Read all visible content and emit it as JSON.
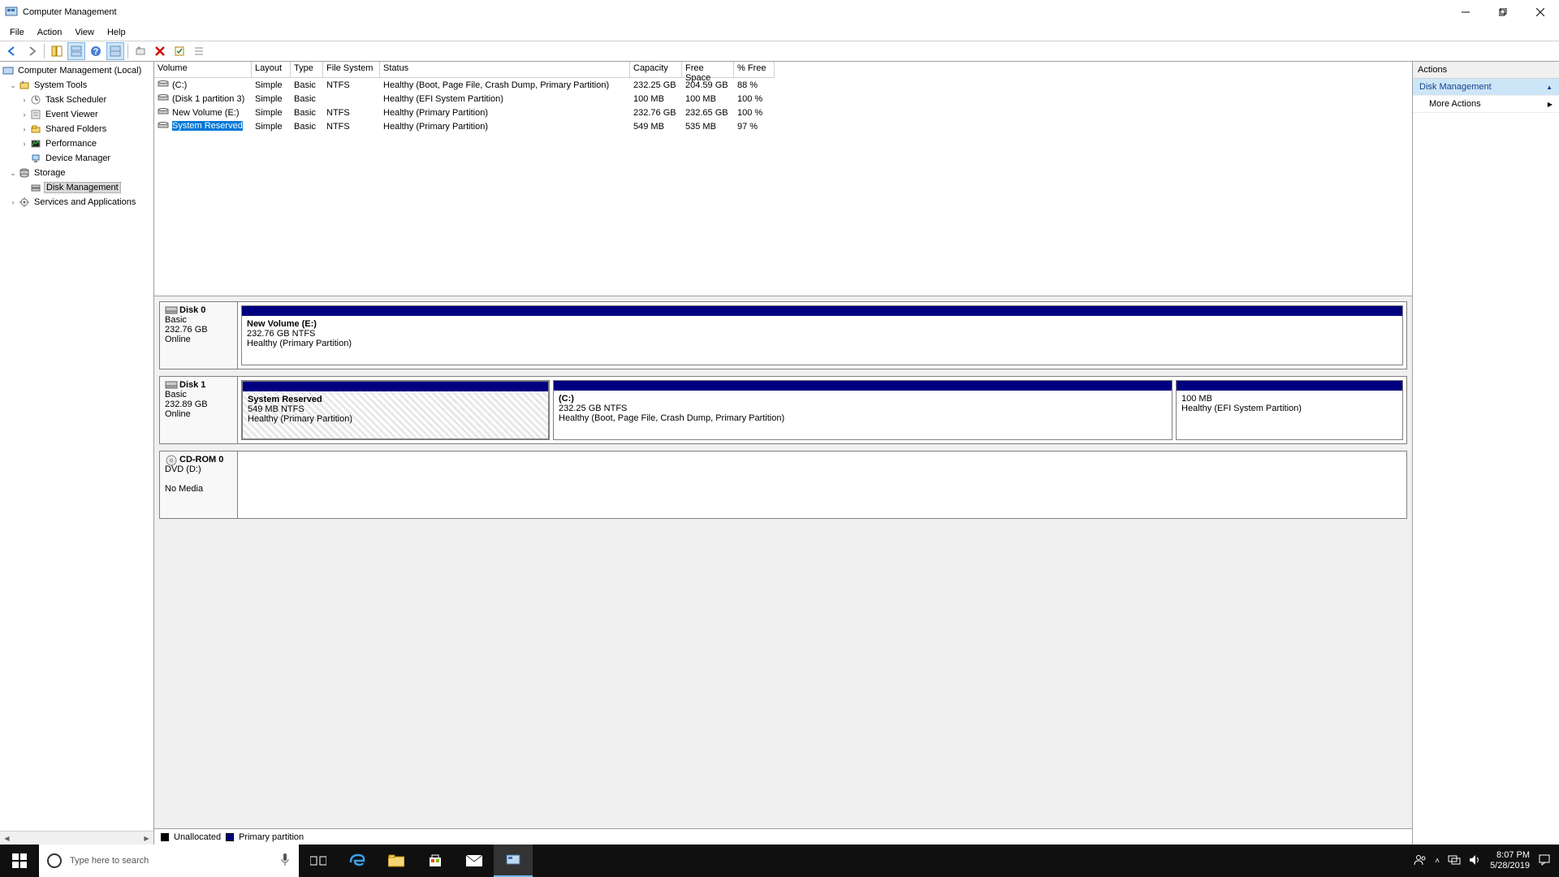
{
  "window": {
    "title": "Computer Management"
  },
  "menu": [
    "File",
    "Action",
    "View",
    "Help"
  ],
  "tree": {
    "root": "Computer Management (Local)",
    "system_tools": "System Tools",
    "task_scheduler": "Task Scheduler",
    "event_viewer": "Event Viewer",
    "shared_folders": "Shared Folders",
    "performance": "Performance",
    "device_manager": "Device Manager",
    "storage": "Storage",
    "disk_management": "Disk Management",
    "services": "Services and Applications"
  },
  "columns": {
    "volume": "Volume",
    "layout": "Layout",
    "type": "Type",
    "fs": "File System",
    "status": "Status",
    "capacity": "Capacity",
    "free": "Free Space",
    "pct": "% Free"
  },
  "volumes": [
    {
      "name": "(C:)",
      "layout": "Simple",
      "type": "Basic",
      "fs": "NTFS",
      "status": "Healthy (Boot, Page File, Crash Dump, Primary Partition)",
      "cap": "232.25 GB",
      "free": "204.59 GB",
      "pct": "88 %",
      "selected": false
    },
    {
      "name": "(Disk 1 partition 3)",
      "layout": "Simple",
      "type": "Basic",
      "fs": "",
      "status": "Healthy (EFI System Partition)",
      "cap": "100 MB",
      "free": "100 MB",
      "pct": "100 %",
      "selected": false
    },
    {
      "name": "New Volume (E:)",
      "layout": "Simple",
      "type": "Basic",
      "fs": "NTFS",
      "status": "Healthy (Primary Partition)",
      "cap": "232.76 GB",
      "free": "232.65 GB",
      "pct": "100 %",
      "selected": false
    },
    {
      "name": "System Reserved",
      "layout": "Simple",
      "type": "Basic",
      "fs": "NTFS",
      "status": "Healthy (Primary Partition)",
      "cap": "549 MB",
      "free": "535 MB",
      "pct": "97 %",
      "selected": true
    }
  ],
  "disks": [
    {
      "name": "Disk 0",
      "type": "Basic",
      "size": "232.76 GB",
      "status": "Online",
      "media": "hdd",
      "parts": [
        {
          "name": "New Volume  (E:)",
          "line2": "232.76 GB NTFS",
          "line3": "Healthy (Primary Partition)",
          "flex": "1",
          "hatched": false
        }
      ]
    },
    {
      "name": "Disk 1",
      "type": "Basic",
      "size": "232.89 GB",
      "status": "Online",
      "media": "hdd",
      "parts": [
        {
          "name": "System Reserved",
          "line2": "549 MB NTFS",
          "line3": "Healthy (Primary Partition)",
          "flex": "0 0 380px",
          "hatched": true
        },
        {
          "name": "(C:)",
          "line2": "232.25 GB NTFS",
          "line3": "Healthy (Boot, Page File, Crash Dump, Primary Partition)",
          "flex": "1",
          "hatched": false
        },
        {
          "name": "",
          "line2": "100 MB",
          "line3": "Healthy (EFI System Partition)",
          "flex": "0 0 280px",
          "hatched": false
        }
      ]
    },
    {
      "name": "CD-ROM 0",
      "type": "DVD (D:)",
      "size": "",
      "status": "No Media",
      "media": "cd",
      "parts": []
    }
  ],
  "legend": {
    "unallocated": "Unallocated",
    "primary": "Primary partition"
  },
  "actions": {
    "header": "Actions",
    "dm": "Disk Management",
    "more": "More Actions"
  },
  "taskbar": {
    "search": "Type here to search",
    "time": "8:07 PM",
    "date": "5/28/2019"
  }
}
